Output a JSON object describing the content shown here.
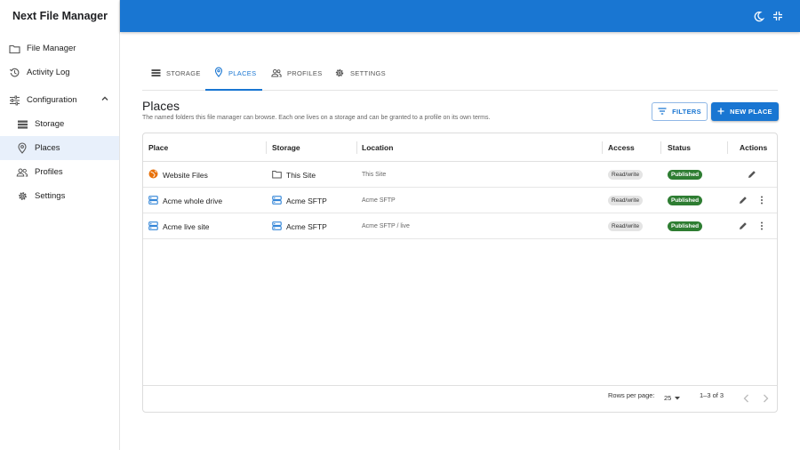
{
  "app": {
    "title": "Next File Manager"
  },
  "sidebar": {
    "file_manager": "File Manager",
    "activity_log": "Activity Log",
    "configuration": "Configuration",
    "storage": "Storage",
    "places": "Places",
    "profiles": "Profiles",
    "settings": "Settings"
  },
  "tabs": {
    "storage": "STORAGE",
    "places": "PLACES",
    "profiles": "PROFILES",
    "settings": "SETTINGS"
  },
  "page": {
    "title": "Places",
    "subtitle": "The named folders this file manager can browse. Each one lives on a storage and can be granted to a profile on its own terms.",
    "filters_label": "FILTERS",
    "new_label": "NEW PLACE"
  },
  "table": {
    "headers": {
      "place": "Place",
      "storage": "Storage",
      "location": "Location",
      "access": "Access",
      "status": "Status",
      "actions": "Actions"
    },
    "rows": [
      {
        "place": "Website Files",
        "place_icon": "globe-icon",
        "storage": "This Site",
        "storage_icon": "folder-icon",
        "location": "This Site",
        "access": "Read/write",
        "status": "Published"
      },
      {
        "place": "Acme whole drive",
        "place_icon": "server-icon",
        "storage": "Acme SFTP",
        "storage_icon": "server-icon",
        "location": "Acme SFTP",
        "access": "Read/write",
        "status": "Published"
      },
      {
        "place": "Acme live site",
        "place_icon": "server-icon",
        "storage": "Acme SFTP",
        "storage_icon": "server-icon",
        "location": "Acme SFTP / live",
        "access": "Read/write",
        "status": "Published"
      }
    ],
    "footer": {
      "rows_per_page_label": "Rows per page:",
      "rows_per_page": "25",
      "range": "1–3 of 3"
    }
  },
  "colors": {
    "primary": "#1976d2",
    "published": "#2e7d32",
    "globe": "#e8710a"
  }
}
